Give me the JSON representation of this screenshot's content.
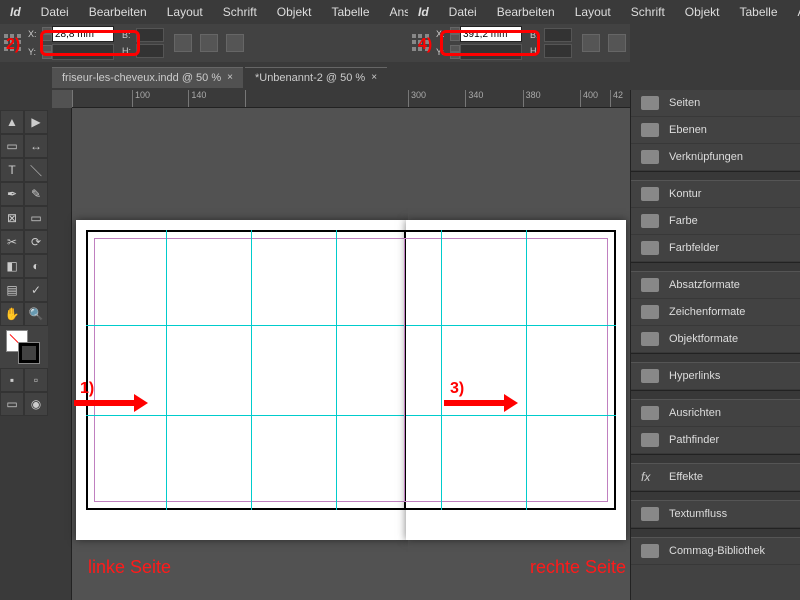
{
  "app": {
    "logo": "Id"
  },
  "menu": [
    "Datei",
    "Bearbeiten",
    "Layout",
    "Schrift",
    "Objekt",
    "Tabelle",
    "Ansic"
  ],
  "control": {
    "left": {
      "x_label": "X:",
      "y_label": "Y:",
      "x_value": "28,8 mm",
      "w_label": "B:",
      "h_label": "H:"
    },
    "right": {
      "x_label": "X:",
      "y_label": "Y:",
      "x_value": "391,2 mm",
      "w_label": "B:",
      "h_label": "H:"
    }
  },
  "tabs": [
    {
      "label": "friseur-les-cheveux.indd @ 50 %"
    },
    {
      "label": "*Unbenannt-2 @ 50 %"
    }
  ],
  "ruler_left": [
    "100",
    "140"
  ],
  "ruler_right": [
    "300",
    "340",
    "380",
    "400",
    "42"
  ],
  "annotations": {
    "a1": "1)",
    "a2": "2)",
    "a3": "3)",
    "a4": "4)"
  },
  "page_labels": {
    "left": "linke Seite",
    "right": "rechte Seite"
  },
  "panels": {
    "g1": [
      "Seiten",
      "Ebenen",
      "Verknüpfungen"
    ],
    "g2": [
      "Kontur",
      "Farbe",
      "Farbfelder"
    ],
    "g3": [
      "Absatzformate",
      "Zeichenformate",
      "Objektformate"
    ],
    "g4": [
      "Hyperlinks"
    ],
    "g5": [
      "Ausrichten",
      "Pathfinder"
    ],
    "g6": [
      "Effekte"
    ],
    "g7": [
      "Textumfluss"
    ],
    "g8": [
      "Commag-Bibliothek"
    ]
  }
}
